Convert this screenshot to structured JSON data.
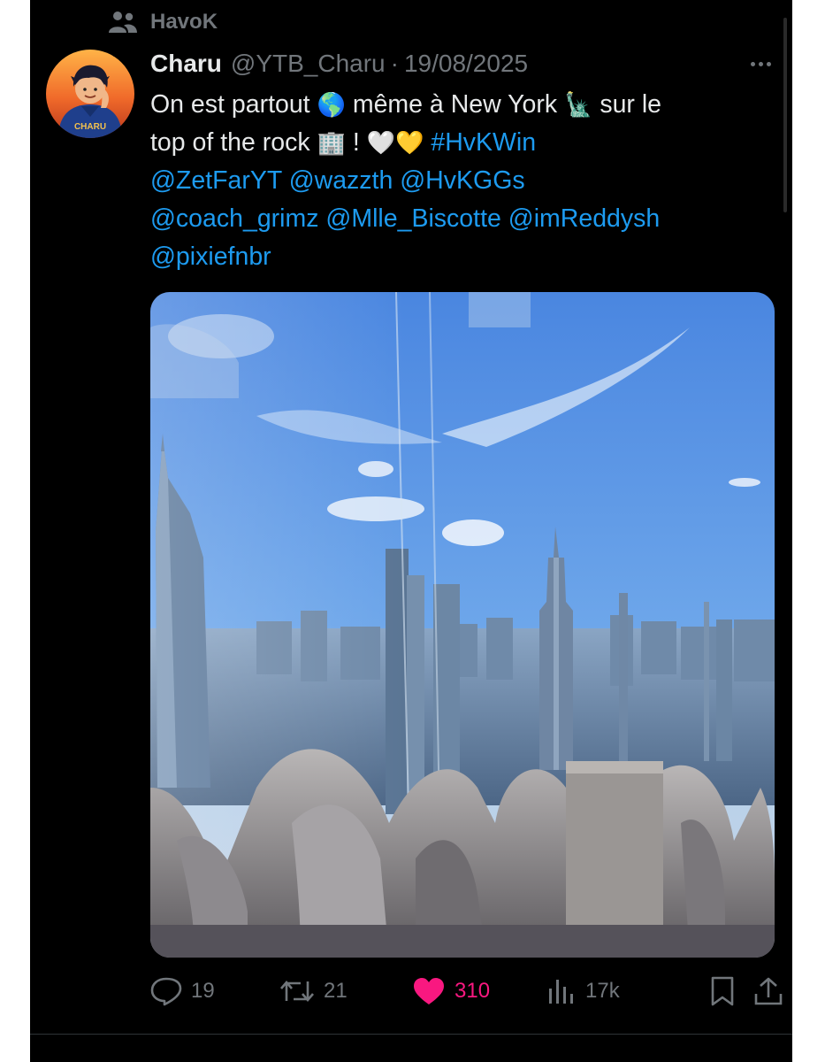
{
  "social_context": "HavoK",
  "tweet": {
    "author_name": "Charu",
    "handle": "@YTB_Charu",
    "separator": "·",
    "date": "19/08/2025",
    "avatar_label": "CHARU",
    "text": {
      "l1_part1": "On est partout",
      "l1_emoji1": "🌎",
      "l1_part2": "même à New York",
      "l1_emoji2": "🗽",
      "l1_part3": "sur le",
      "l2_part1": "top of the rock",
      "l2_emoji1": "🏢",
      "l2_part2": "!",
      "l2_emoji2": "🤍💛",
      "hashtag": "#HvKWin",
      "mention_1": "@ZetFarYT",
      "mention_2": "@wazzth",
      "mention_3": "@HvKGGs",
      "mention_4": "@coach_grimz",
      "mention_5": "@Mlle_Biscotte",
      "mention_6": "@imReddysh",
      "mention_7": "@pixiefnbr"
    }
  },
  "actions": {
    "replies": "19",
    "reposts": "21",
    "likes": "310",
    "views": "17k"
  },
  "colors": {
    "background": "#000000",
    "text": "#e7e9ea",
    "secondary": "#71767b",
    "link": "#1d9bf0",
    "like": "#f91880"
  },
  "icons": [
    "people-icon",
    "more-icon",
    "reply-icon",
    "repost-icon",
    "heart-icon",
    "views-icon",
    "bookmark-icon",
    "share-icon"
  ]
}
